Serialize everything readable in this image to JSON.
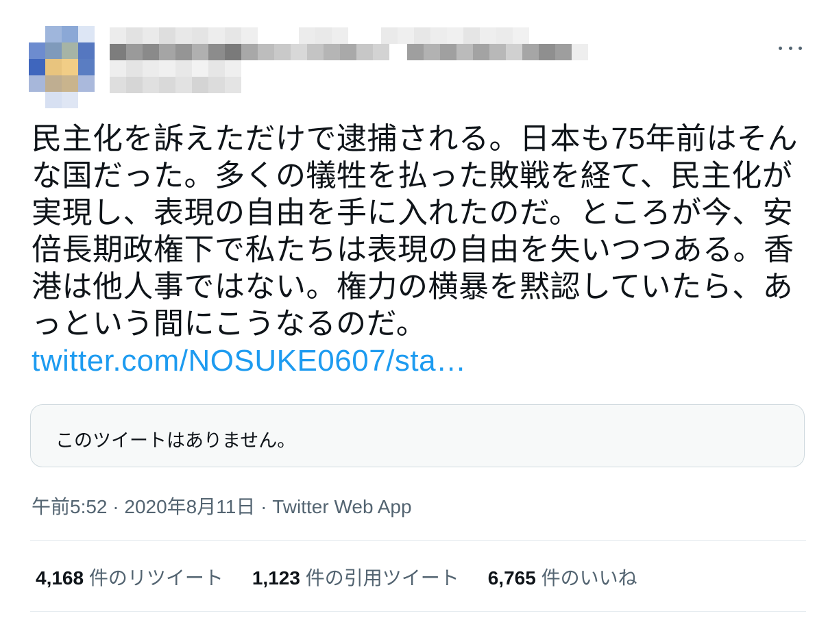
{
  "author": {
    "avatar": "avatar-pixelated",
    "display_name_obscured": true,
    "handle_obscured": true
  },
  "more_icon": "more-horizontal-icon",
  "tweet": {
    "text": "民主化を訴えただけで逮捕される。日本も75年前はそんな国だった。多くの犠牲を払った敗戦を経て、民主化が実現し、表現の自由を手に入れたのだ。ところが今、安倍長期政権下で私たちは表現の自由を失いつつある。香港は他人事ではない。権力の横暴を黙認していたら、あっという間にこうなるのだ。",
    "link_text": "twitter.com/NOSUKE0607/sta…",
    "link_color": "#1d9bf0"
  },
  "quoted": {
    "unavailable_text": "このツイートはありません。"
  },
  "meta": {
    "time": "午前5:52",
    "separator1": " · ",
    "date": "2020年8月11日",
    "separator2": " · ",
    "source": "Twitter Web App"
  },
  "stats": {
    "retweets_count": "4,168",
    "retweets_label": " 件のリツイート",
    "quotes_count": "1,123",
    "quotes_label": " 件の引用ツイート",
    "likes_count": "6,765",
    "likes_label": " 件のいいね"
  },
  "colors": {
    "text": "#0f1419",
    "secondary": "#536471",
    "link": "#1d9bf0",
    "border": "#cfd9de"
  }
}
